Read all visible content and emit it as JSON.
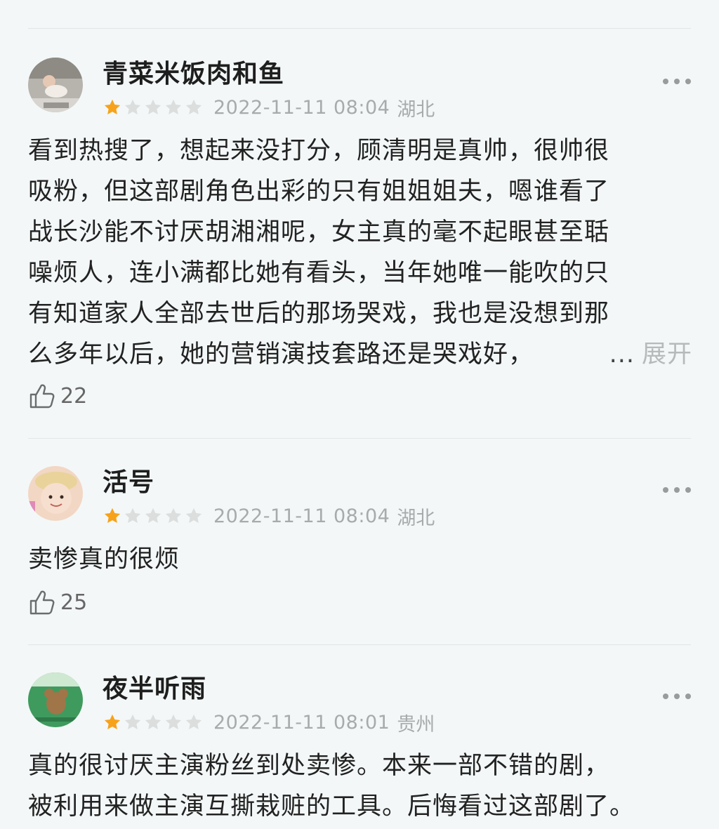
{
  "reviews": [
    {
      "username": "青菜米饭肉和鱼",
      "rating": 1,
      "date": "2022-11-11 08:04",
      "location": "湖北",
      "text_lines": [
        "看到热搜了，想起来没打分，顾清明是真帅，很帅很",
        "吸粉，但这部剧角色出彩的只有姐姐姐夫，嗯谁看了",
        "战长沙能不讨厌胡湘湘呢，女主真的毫不起眼甚至聒",
        "噪烦人，连小满都比她有看头，当年她唯一能吹的只",
        "有知道家人全部去世后的那场哭戏，我也是没想到那",
        "么多年以后，她的营销演技套路还是哭戏好，"
      ],
      "ellipsis": "...",
      "expand_label": "展开",
      "likes": "22"
    },
    {
      "username": "活号",
      "rating": 1,
      "date": "2022-11-11 08:04",
      "location": "湖北",
      "text_lines": [
        "卖惨真的很烦"
      ],
      "likes": "25"
    },
    {
      "username": "夜半听雨",
      "rating": 1,
      "date": "2022-11-11 08:01",
      "location": "贵州",
      "text_lines": [
        "真的很讨厌主演粉丝到处卖惨。本来一部不错的剧，",
        "被利用来做主演互撕栽赃的工具。后悔看过这部剧了。"
      ]
    }
  ],
  "colors": {
    "star_filled": "#f7a21b",
    "star_empty": "#dcdede",
    "meta_text": "#a8abab",
    "expand_text": "#b7baba",
    "background": "#f3f7f7"
  },
  "icons": [
    "more-icon",
    "thumbs-up-icon",
    "star-icon"
  ]
}
